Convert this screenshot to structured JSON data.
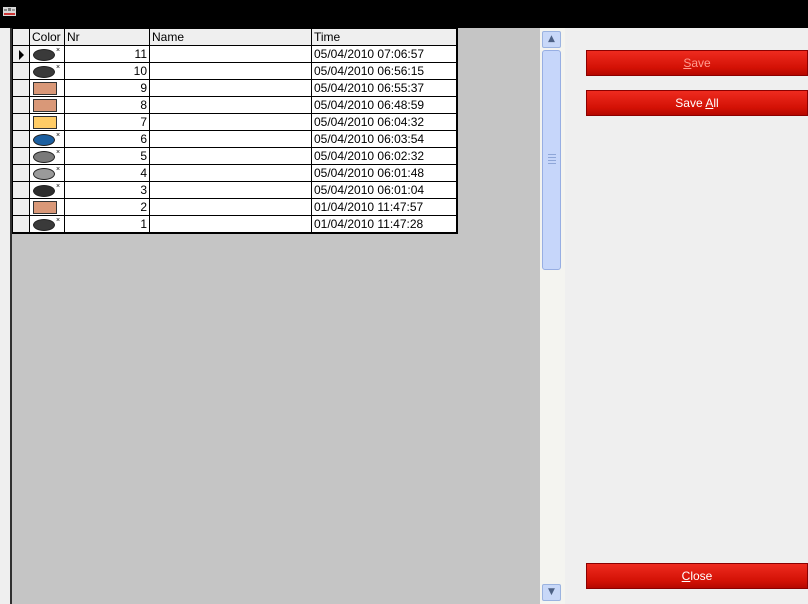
{
  "grid": {
    "columns": [
      "Color",
      "Nr",
      "Name",
      "Time"
    ],
    "rows": [
      {
        "nr": "11",
        "name": "",
        "time": "05/04/2010 07:06:57",
        "swatch": "ellipse",
        "color": "#3a3a3a",
        "selected": true
      },
      {
        "nr": "10",
        "name": "",
        "time": "05/04/2010 06:56:15",
        "swatch": "ellipse",
        "color": "#3a3a3a",
        "selected": false
      },
      {
        "nr": "9",
        "name": "",
        "time": "05/04/2010 06:55:37",
        "swatch": "rect",
        "color": "#d99878",
        "selected": false
      },
      {
        "nr": "8",
        "name": "",
        "time": "05/04/2010 06:48:59",
        "swatch": "rect",
        "color": "#d99878",
        "selected": false
      },
      {
        "nr": "7",
        "name": "",
        "time": "05/04/2010 06:04:32",
        "swatch": "rect",
        "color": "#ffcc66",
        "selected": false
      },
      {
        "nr": "6",
        "name": "",
        "time": "05/04/2010 06:03:54",
        "swatch": "ellipse",
        "color": "#1c5fa0",
        "selected": false
      },
      {
        "nr": "5",
        "name": "",
        "time": "05/04/2010 06:02:32",
        "swatch": "ellipse",
        "color": "#7a7a7a",
        "selected": false
      },
      {
        "nr": "4",
        "name": "",
        "time": "05/04/2010 06:01:48",
        "swatch": "ellipse",
        "color": "#9a9a9a",
        "selected": false
      },
      {
        "nr": "3",
        "name": "",
        "time": "05/04/2010 06:01:04",
        "swatch": "ellipse",
        "color": "#2e2e2e",
        "selected": false
      },
      {
        "nr": "2",
        "name": "",
        "time": "01/04/2010 11:47:57",
        "swatch": "rect",
        "color": "#d99878",
        "selected": false
      },
      {
        "nr": "1",
        "name": "",
        "time": "01/04/2010 11:47:28",
        "swatch": "ellipse",
        "color": "#3a3a3a",
        "selected": false
      }
    ]
  },
  "buttons": {
    "save": {
      "pre": "",
      "key": "S",
      "post": "ave",
      "enabled": false
    },
    "save_all": {
      "pre": "Save ",
      "key": "A",
      "post": "ll",
      "enabled": true
    },
    "close": {
      "pre": "",
      "key": "C",
      "post": "lose",
      "enabled": true
    }
  },
  "scrollbar": {
    "up_icon": "scroll-up-arrow-icon",
    "down_icon": "scroll-down-arrow-icon"
  },
  "icons": {
    "app": "app-logo-icon",
    "current_row": "current-row-arrow-icon"
  }
}
